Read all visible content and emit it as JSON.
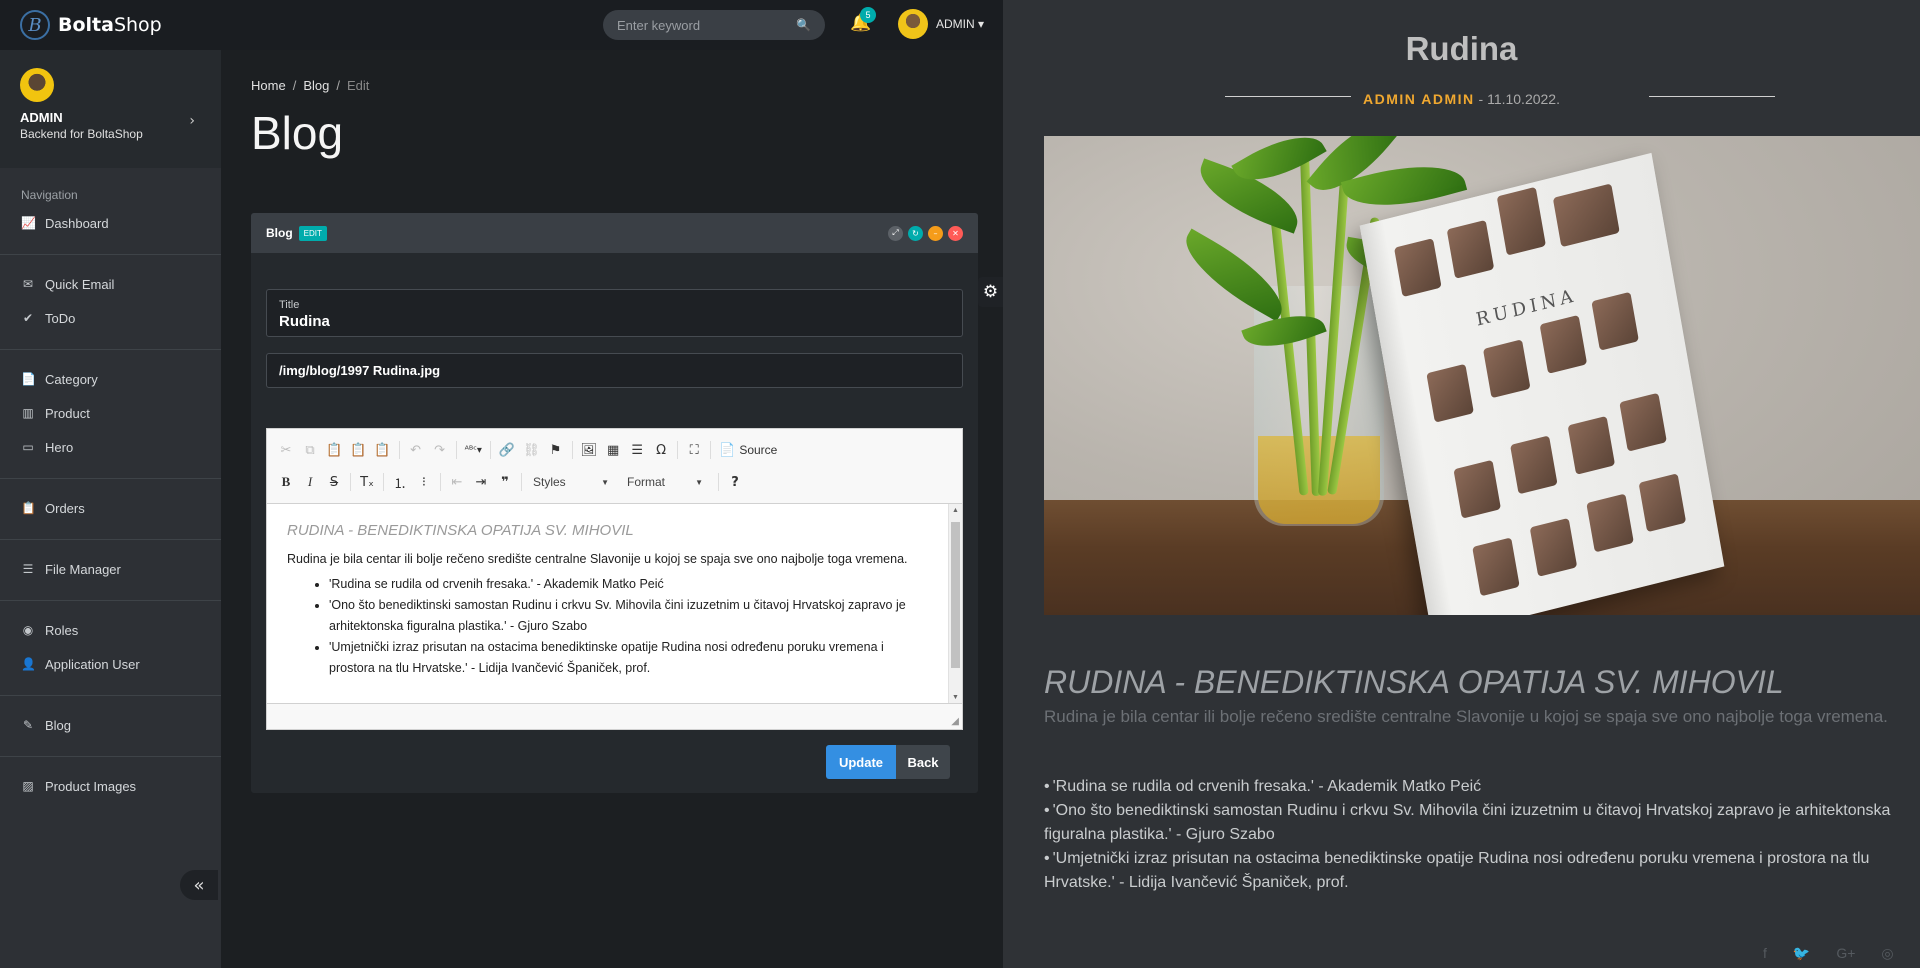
{
  "brand": {
    "logo_letter": "B",
    "name_bold": "Bolta",
    "name_light": "Shop"
  },
  "header": {
    "search_placeholder": "Enter keyword",
    "notifications_count": "5",
    "user_label": "ADMIN ▾"
  },
  "sidebar": {
    "profile": {
      "name": "ADMIN",
      "subtitle": "Backend for BoltaShop"
    },
    "nav_header": "Navigation",
    "items": [
      {
        "label": "Dashboard",
        "icon": "chart-line-icon",
        "glyph": "📈"
      },
      {
        "label": "Quick Email",
        "icon": "envelope-icon",
        "glyph": "✉"
      },
      {
        "label": "ToDo",
        "icon": "check-circle-icon",
        "glyph": "✔"
      },
      {
        "label": "Category",
        "icon": "file-icon",
        "glyph": "📄"
      },
      {
        "label": "Product",
        "icon": "barcode-icon",
        "glyph": "▥"
      },
      {
        "label": "Hero",
        "icon": "cast-icon",
        "glyph": "▭"
      },
      {
        "label": "Orders",
        "icon": "file-alt-icon",
        "glyph": "📋"
      },
      {
        "label": "File Manager",
        "icon": "database-icon",
        "glyph": "☰"
      },
      {
        "label": "Roles",
        "icon": "globe-icon",
        "glyph": "◉"
      },
      {
        "label": "Application User",
        "icon": "user-icon",
        "glyph": "👤"
      },
      {
        "label": "Blog",
        "icon": "blog-icon",
        "glyph": "✎"
      },
      {
        "label": "Product Images",
        "icon": "image-icon",
        "glyph": "▨"
      }
    ]
  },
  "breadcrumb": {
    "home": "Home",
    "blog": "Blog",
    "current": "Edit"
  },
  "page_title": "Blog",
  "panel": {
    "title": "Blog",
    "badge": "EDIT",
    "title_field": {
      "label": "Title",
      "value": "Rudina"
    },
    "image_path": "/img/blog/1997 Rudina.jpg",
    "toolbar": {
      "source_label": "Source",
      "styles_label": "Styles",
      "format_label": "Format"
    },
    "editor": {
      "heading": "RUDINA - BENEDIKTINSKA OPATIJA SV. MIHOVIL",
      "paragraph": "Rudina je bila centar ili bolje rečeno središte centralne Slavonije u kojoj se spaja sve ono najbolje toga vremena.",
      "list": [
        "'Rudina se rudila od crvenih fresaka.' - Akademik Matko Peić",
        "'Ono što benediktinski samostan Rudinu i crkvu Sv. Mihovila čini izuzetnim u čitavoj Hrvatskoj zapravo je arhitektonska figuralna plastika.' - Gjuro Szabo",
        "'Umjetnički izraz prisutan na ostacima benediktinske opatije Rudina nosi određenu poruku vremena i prostora na tlu Hrvatske.' - Lidija Ivančević Španiček, prof."
      ]
    },
    "update_label": "Update",
    "back_label": "Back"
  },
  "preview": {
    "title": "Rudina",
    "author": "ADMIN ADMIN",
    "date": " - 11.10.2022.",
    "book_title": "RUDINA",
    "heading": "RUDINA - BENEDIKTINSKA OPATIJA SV. MIHOVIL",
    "paragraph": "Rudina je bila centar ili bolje rečeno središte centralne Slavonije u kojoj se spaja sve ono najbolje toga vremena.",
    "list": [
      "'Rudina se rudila od crvenih fresaka.' - Akademik Matko Peić",
      "'Ono što benediktinski samostan Rudinu i crkvu Sv. Mihovila čini izuzetnim u čitavoj Hrvatskoj zapravo je arhitektonska figuralna plastika.' - Gjuro Szabo",
      "'Umjetnički izraz prisutan na ostacima benediktinske opatije Rudina nosi određenu poruku vremena i prostora na tlu Hrvatske.' - Lidija Ivančević Španiček, prof."
    ],
    "social": [
      "f",
      "🐦",
      "G+",
      "◎"
    ]
  },
  "colors": {
    "accent_teal": "#00acac",
    "primary_blue": "#348fe2",
    "author_orange": "#f0a830"
  }
}
